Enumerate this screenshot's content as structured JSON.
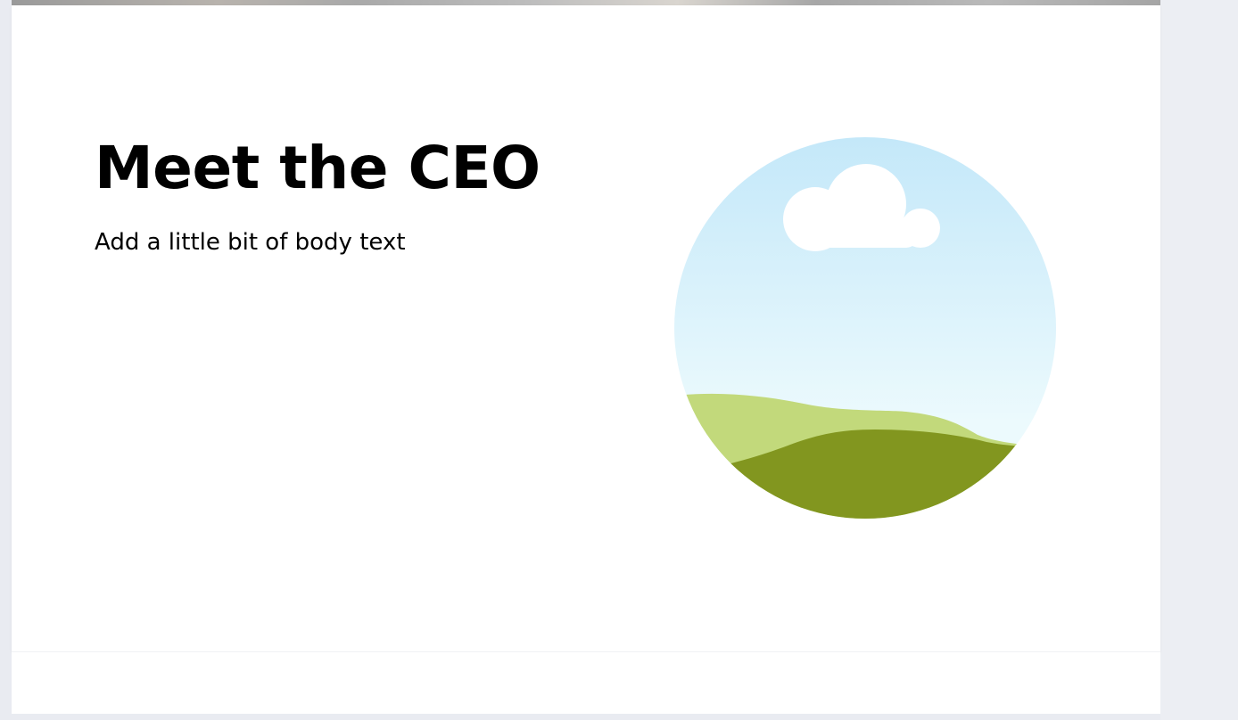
{
  "slide": {
    "title": "Meet the CEO",
    "body": "Add a little bit of body text"
  },
  "image_placeholder": {
    "icon": "landscape-placeholder-icon",
    "colors": {
      "sky_top": "#c4e8f9",
      "sky_bottom": "#ecfafd",
      "cloud": "#ffffff",
      "hill_light": "#c2d97b",
      "hill_dark": "#82961f"
    }
  },
  "colors": {
    "workspace_background": "#e9ebf1",
    "slide_background": "#ffffff",
    "text": "#000000"
  }
}
